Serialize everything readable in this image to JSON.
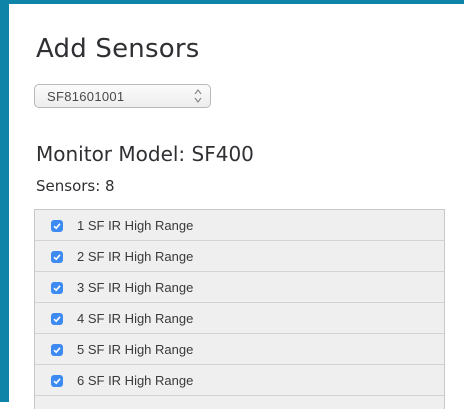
{
  "title": "Add Sensors",
  "serial_select": {
    "value": "SF81601001"
  },
  "monitor_model": "Monitor Model: SF400",
  "sensors_count": "Sensors: 8",
  "sensors": [
    {
      "label": "1 SF IR High Range",
      "checked": true
    },
    {
      "label": "2 SF IR High Range",
      "checked": true
    },
    {
      "label": "3 SF IR High Range",
      "checked": true
    },
    {
      "label": "4 SF IR High Range",
      "checked": true
    },
    {
      "label": "5 SF IR High Range",
      "checked": true
    },
    {
      "label": "6 SF IR High Range",
      "checked": true
    }
  ],
  "colors": {
    "frame_accent": "#0e84a9",
    "checkbox": "#3d8bf2"
  }
}
